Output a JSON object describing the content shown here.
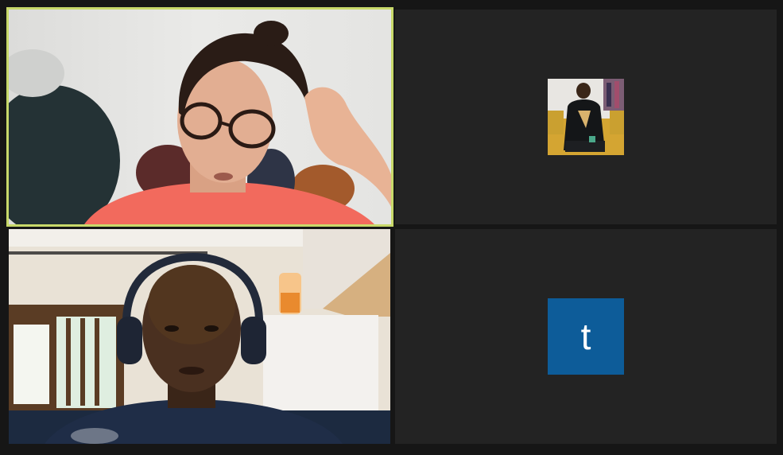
{
  "meeting": {
    "layout": "gallery-2x2",
    "background_color": "#161616",
    "tile_color": "#232323",
    "active_speaker_border_color": "#c8d96a"
  },
  "participants": [
    {
      "video_on": true,
      "active_speaker": true,
      "feed": "camera-woman-glasses"
    },
    {
      "video_on": false,
      "display": "profile-photo",
      "feed": "profile-photo-man-on-yellow-sofa"
    },
    {
      "video_on": true,
      "active_speaker": false,
      "feed": "camera-man-headphones"
    },
    {
      "video_on": false,
      "display": "letter-avatar",
      "avatar_letter": "t",
      "avatar_color": "#0d5c99"
    }
  ]
}
